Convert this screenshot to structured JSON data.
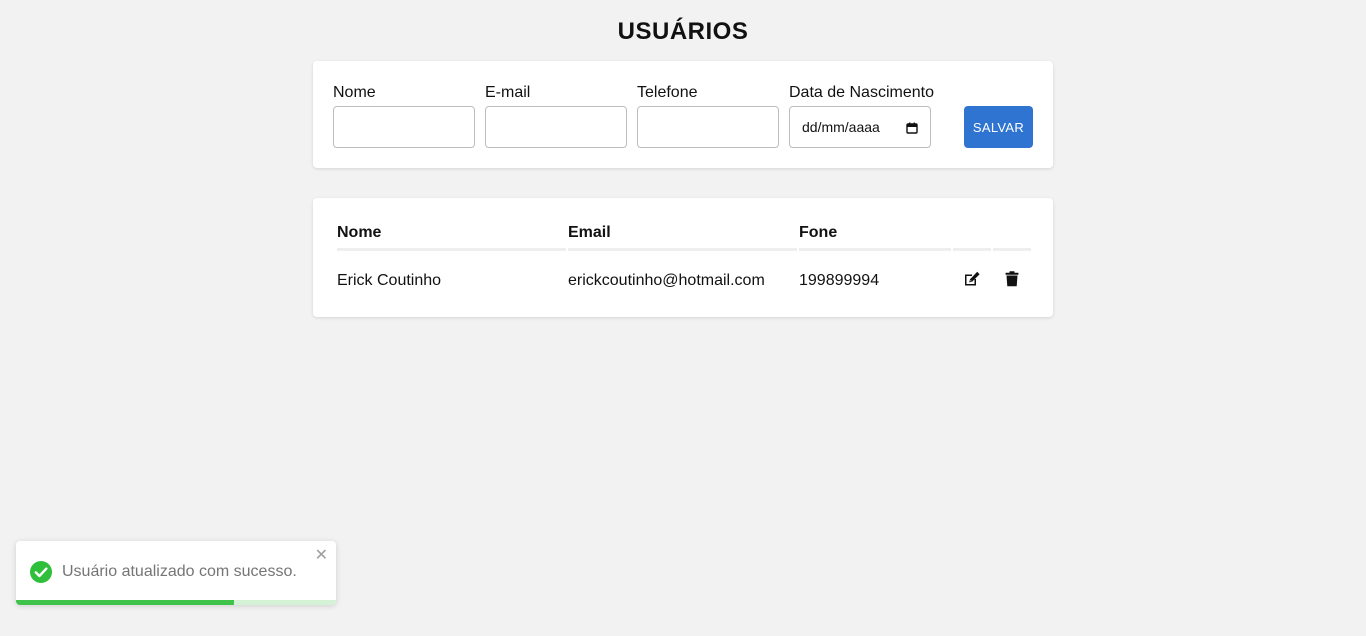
{
  "page": {
    "title": "USUÁRIOS"
  },
  "form": {
    "fields": [
      {
        "label": "Nome",
        "value": "",
        "placeholder": ""
      },
      {
        "label": "E-mail",
        "value": "",
        "placeholder": ""
      },
      {
        "label": "Telefone",
        "value": "",
        "placeholder": ""
      },
      {
        "label": "Data de Nascimento",
        "value": "dd/mm/aaaa",
        "placeholder": "dd/mm/aaaa"
      }
    ],
    "save_label": "SALVAR",
    "accent_color": "#2f74d0"
  },
  "table": {
    "headers": [
      "Nome",
      "Email",
      "Fone"
    ],
    "rows": [
      {
        "nome": "Erick Coutinho",
        "email": "erickcoutinho@hotmail.com",
        "fone": "199899994",
        "edit_icon": "edit-icon",
        "delete_icon": "trash-icon"
      }
    ]
  },
  "toast": {
    "message": "Usuário atualizado com sucesso.",
    "close_label": "✕",
    "icon": "check-circle-icon",
    "progress": 0.68,
    "color": "#3fc34b"
  }
}
